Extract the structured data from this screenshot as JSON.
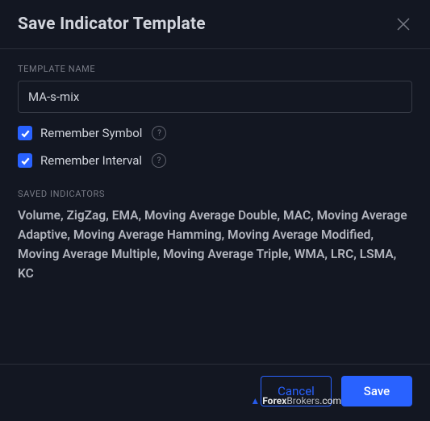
{
  "dialog": {
    "title": "Save Indicator Template"
  },
  "templateName": {
    "label": "TEMPLATE NAME",
    "value": "MA-s-mix"
  },
  "options": {
    "rememberSymbol": {
      "label": "Remember Symbol",
      "checked": true
    },
    "rememberInterval": {
      "label": "Remember Interval",
      "checked": true
    }
  },
  "savedIndicators": {
    "label": "SAVED INDICATORS",
    "list": "Volume, ZigZag, EMA, Moving Average Double, MAC, Moving Average Adaptive, Moving Average Hamming, Moving Average Modified, Moving Average Multiple, Moving Average Triple, WMA, LRC, LSMA, KC"
  },
  "buttons": {
    "cancel": "Cancel",
    "save": "Save"
  },
  "watermark": {
    "prefix": "Forex",
    "suffix": "Brokers",
    "tld": ".com"
  }
}
